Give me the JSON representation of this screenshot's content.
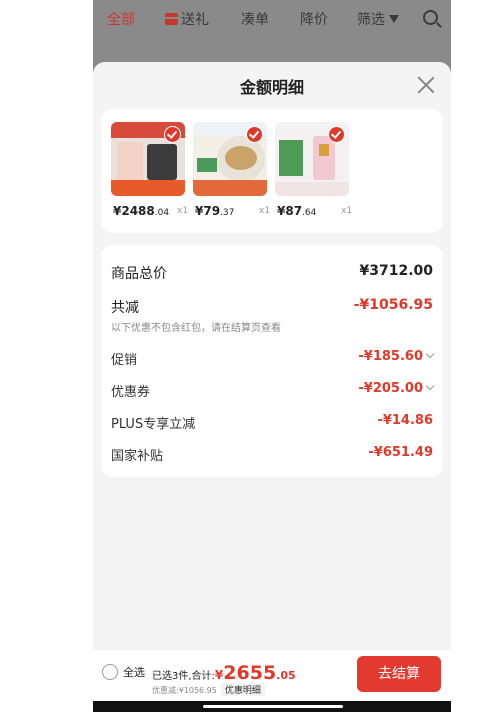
{
  "topbar": {
    "tab_all": "全部",
    "tab_gift": "送礼",
    "tab_combine": "凑单",
    "tab_pricedrop": "降价",
    "tab_filter": "筛选"
  },
  "sheet": {
    "title": "金额明细"
  },
  "products": [
    {
      "price_int": "¥2488",
      "price_dec": ".04",
      "qty": "x1"
    },
    {
      "price_int": "¥79",
      "price_dec": ".37",
      "qty": "x1"
    },
    {
      "price_int": "¥87",
      "price_dec": ".64",
      "qty": "x1"
    }
  ],
  "summary": {
    "total_label": "商品总价",
    "total_value": "¥3712.00",
    "reduce_label": "共减",
    "reduce_value": "-¥1056.95",
    "reduce_note": "以下优惠不包含红包，请在结算页查看",
    "promo_label": "促销",
    "promo_value": "-¥185.60",
    "coupon_label": "优惠券",
    "coupon_value": "-¥205.00",
    "plus_label": "PLUS专享立减",
    "plus_value": "-¥14.86",
    "subsidy_label": "国家补贴",
    "subsidy_value": "-¥651.49"
  },
  "footer": {
    "select_all": "全选",
    "selected_text": "已选3件,合计:",
    "total_symbol": "¥",
    "total_int": "2655",
    "total_dec": ".05",
    "discount_text": "优惠减:¥1056.95",
    "detail_link": "优惠明细",
    "checkout": "去结算"
  },
  "colors": {
    "accent": "#e0382b",
    "overlay": "#8a8a8a",
    "sheet_bg": "#f4f4f4"
  }
}
